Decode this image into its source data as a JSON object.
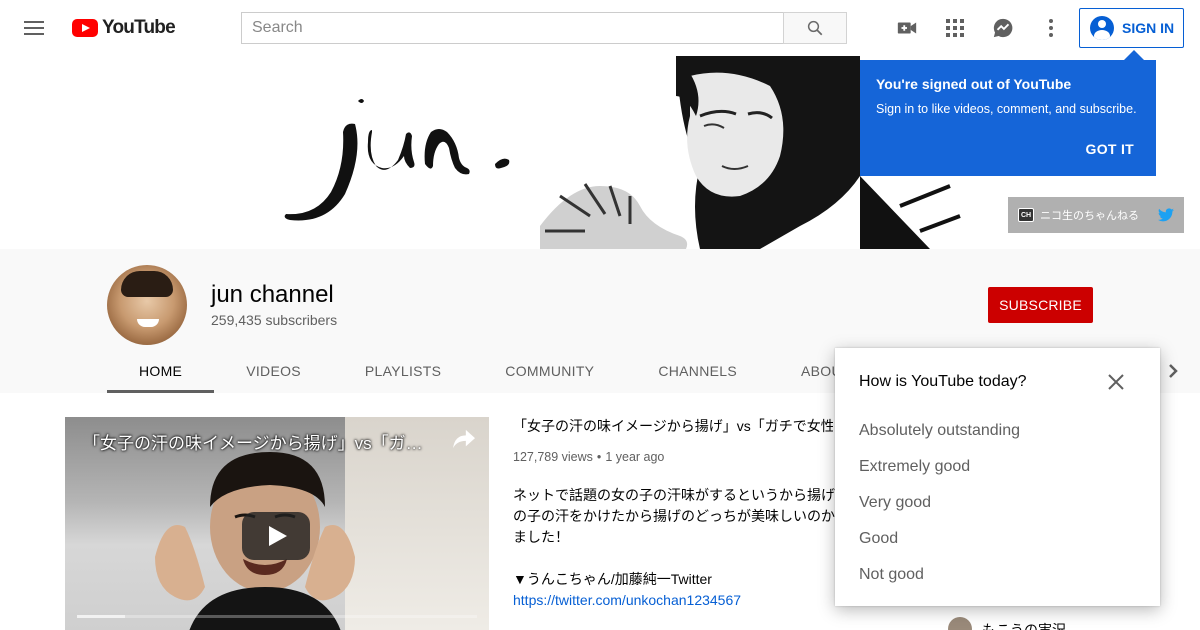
{
  "header": {
    "logo_text": "YouTube",
    "search_placeholder": "Search",
    "sign_in_label": "SIGN IN"
  },
  "signed_out_popup": {
    "title": "You're signed out of YouTube",
    "subtitle": "Sign in to like videos, comment, and subscribe.",
    "got_it_label": "GOT IT"
  },
  "banner": {
    "link_label": "ニコ生のちゃんねる",
    "ch_badge": "CH"
  },
  "channel": {
    "name": "jun channel",
    "subscribers": "259,435 subscribers",
    "subscribe_label": "SUBSCRIBE",
    "tabs": [
      {
        "label": "HOME"
      },
      {
        "label": "VIDEOS"
      },
      {
        "label": "PLAYLISTS"
      },
      {
        "label": "COMMUNITY"
      },
      {
        "label": "CHANNELS"
      },
      {
        "label": "ABOUT"
      }
    ]
  },
  "featured_video": {
    "thumb_title": "「女子の汗の味イメージから揚げ」vs「ガ…",
    "title": "「女子の汗の味イメージから揚げ」vs「ガチで女性",
    "views": "127,789 views",
    "age": "1 year ago",
    "desc_lines": [
      "ネットで話題の女の子の汗味がするというから揚げ",
      "の子の汗をかけたから揚げのどっちが美味しいのか",
      "ました！"
    ],
    "twitter_line": "▼うんこちゃん/加藤純一Twitter",
    "twitter_link": "https://twitter.com/unkochan1234567",
    "progress": 0.12
  },
  "sidebar": {
    "partial_channel_name": "もこうの実況"
  },
  "survey": {
    "title": "How is YouTube today?",
    "options": [
      {
        "label": "Absolutely outstanding"
      },
      {
        "label": "Extremely good"
      },
      {
        "label": "Very good"
      },
      {
        "label": "Good"
      },
      {
        "label": "Not good"
      }
    ]
  },
  "colors": {
    "brand_red": "#ff0000",
    "subscribe_red": "#cc0000",
    "link_blue": "#065fd4",
    "popup_blue": "#1565d8"
  }
}
